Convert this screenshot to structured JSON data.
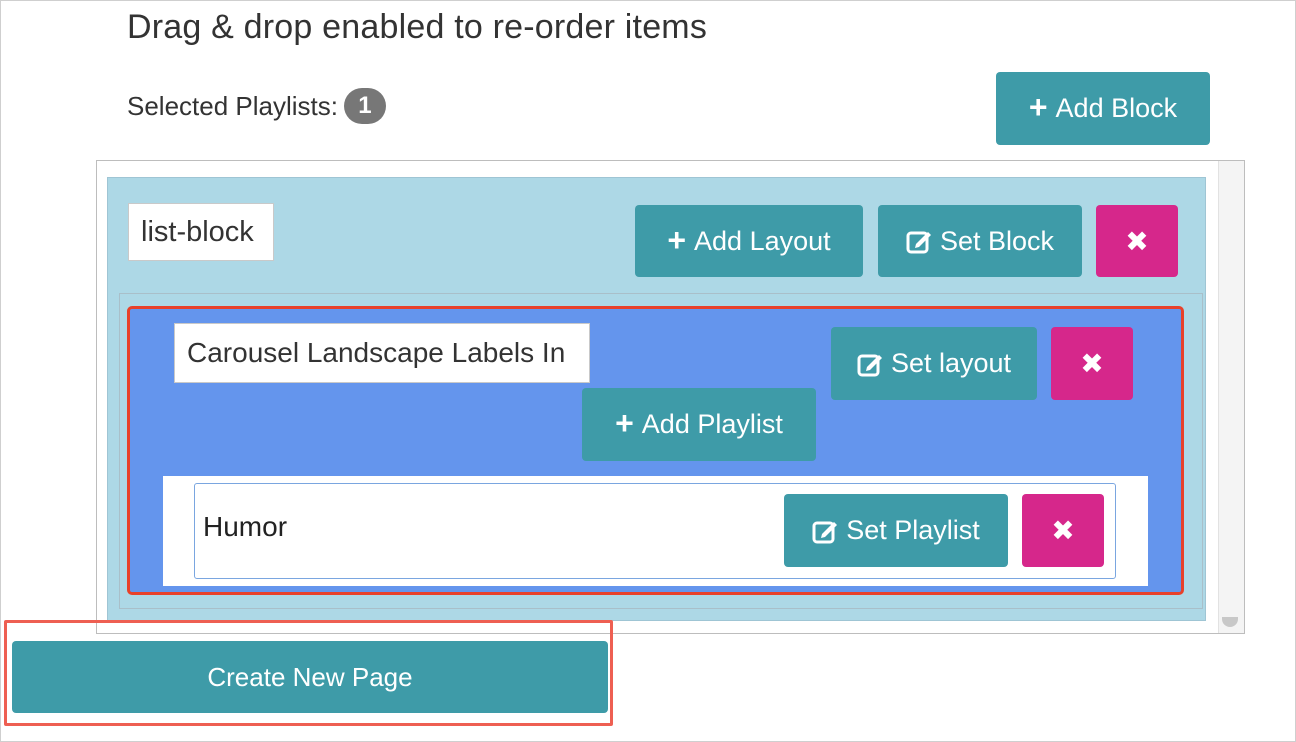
{
  "heading": "Drag & drop enabled to re-order items",
  "selected": {
    "label": "Selected Playlists:",
    "count": "1"
  },
  "toolbar": {
    "add_block_label": "Add Block"
  },
  "block": {
    "name_value": "list-block",
    "add_layout_label": "Add Layout",
    "set_block_label": "Set Block",
    "delete_glyph": "✖"
  },
  "layout": {
    "name_value": "Carousel Landscape Labels In",
    "set_layout_label": "Set layout",
    "add_playlist_label": "Add Playlist",
    "delete_glyph": "✖"
  },
  "playlist": {
    "name": "Humor",
    "set_playlist_label": "Set Playlist",
    "delete_glyph": "✖"
  },
  "footer": {
    "create_page_label": "Create New Page"
  },
  "colors": {
    "teal": "#3e9ba8",
    "pink": "#d6278b",
    "block_bg": "#add8e6",
    "layout_bg": "#6495ed",
    "highlight_red": "#e8412a"
  },
  "icons": {
    "plus": "+",
    "edit": "edit-icon",
    "close": "✖"
  }
}
